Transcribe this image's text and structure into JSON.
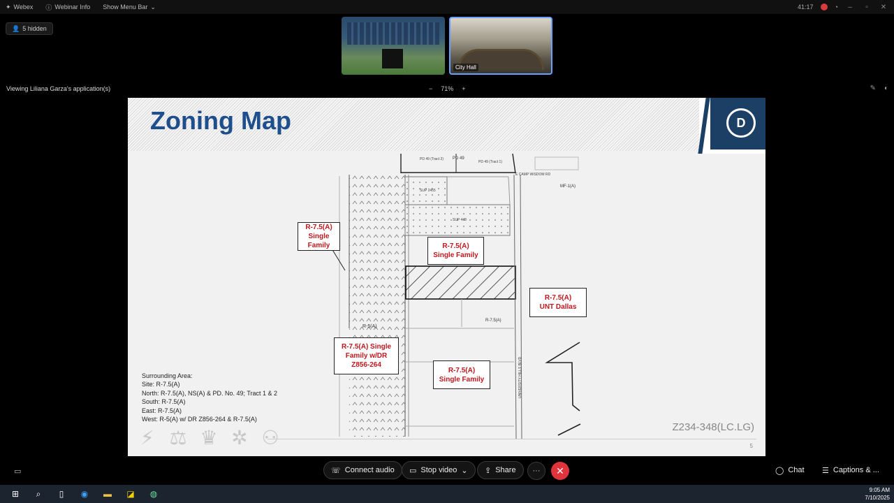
{
  "topbar": {
    "app_name": "Webex",
    "info_label": "Webinar Info",
    "menu_label": "Show Menu Bar",
    "timer": "41:17"
  },
  "hidden_count": "5 hidden",
  "thumbnails": [
    {
      "label": ""
    },
    {
      "label": "City Hall"
    }
  ],
  "viewing_text": "Viewing Liliana Garza's application(s)",
  "zoom": {
    "minus": "−",
    "level": "71%",
    "plus": "+"
  },
  "slide": {
    "title": "Zoning Map",
    "logo_text": "D",
    "labels": {
      "north_west": [
        "R-7.5(A)",
        "Single",
        "Family"
      ],
      "center": [
        "R-7.5(A)",
        "Single Family"
      ],
      "east": [
        "R-7.5(A)",
        "UNT Dallas"
      ],
      "south_west": [
        "R-7.5(A) Single",
        "Family w/DR",
        "Z856-264"
      ],
      "south": [
        "R-7.5(A)",
        "Single Family"
      ]
    },
    "map_text": {
      "pd_tract2": "PD 49 (Tract 2)",
      "pd_49": "PD 49",
      "pd_tract1": "PD 49 (Tract 1)",
      "road_name": "E CAMP WISDOM RD",
      "mf": "MF-1(A)",
      "sup1": "SUP 2455",
      "sup2": "SUP 448",
      "r75_small": "R-7.5(A)",
      "r5": "R-5(A)",
      "univ": "UNIVERSITY HILLS BLVD"
    },
    "surrounding": {
      "heading": "Surrounding Area:",
      "site": "Site: R-7.5(A)",
      "north": "North: R-7.5(A), NS(A) & PD. No. 49; Tract 1 & 2",
      "south": "South: R-7.5(A)",
      "east": "East: R-7.5(A)",
      "west": "West: R-5(A) w/ DR Z856-264 & R-7.5(A)"
    },
    "case_number": "Z234-348(LC.LG)",
    "page_number": "5"
  },
  "toolbar": {
    "connect_audio": "Connect audio",
    "stop_video": "Stop video",
    "share": "Share",
    "more": "···",
    "end": "✕",
    "chat": "Chat",
    "captions": "Captions & ..."
  },
  "clock": {
    "time": "9:05 AM",
    "date": "7/10/2025"
  }
}
